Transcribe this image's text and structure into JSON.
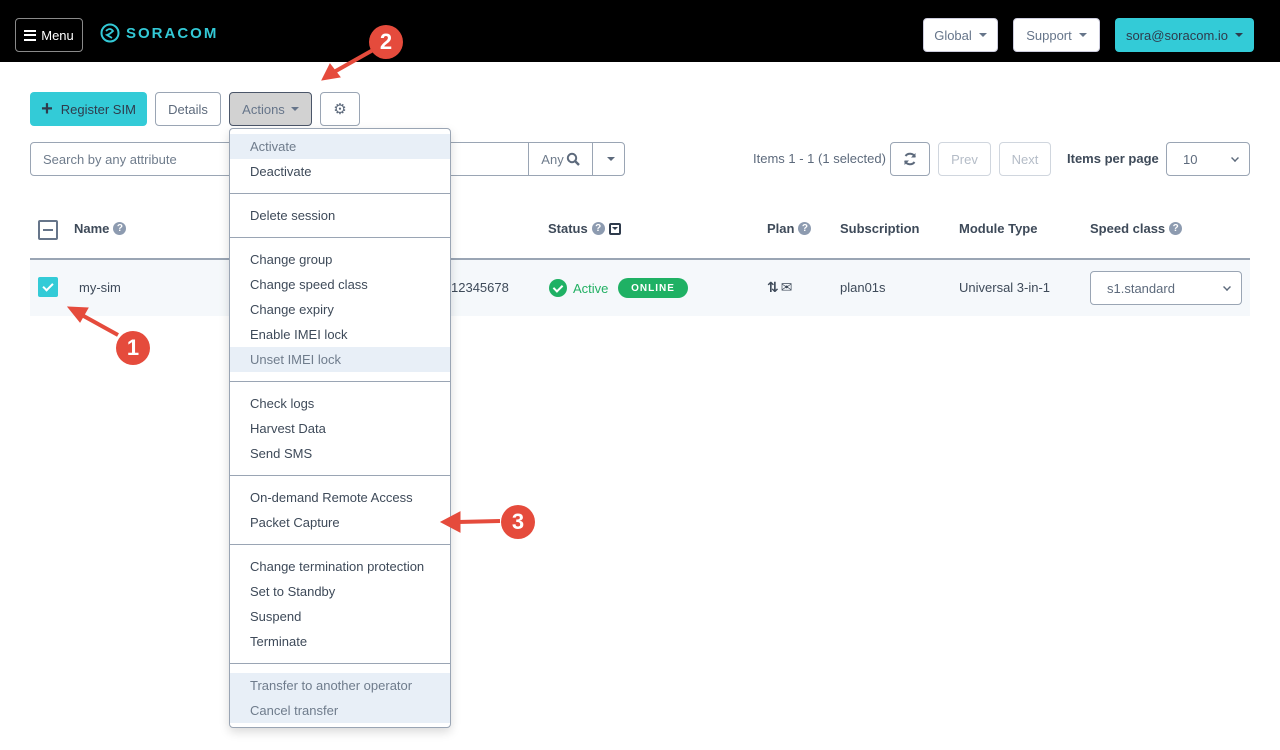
{
  "topbar": {
    "menu_label": "Menu",
    "logo_text": "SORACOM",
    "region_label": "Global",
    "support_label": "Support",
    "user_label": "sora@soracom.io"
  },
  "toolbar": {
    "register_label": "Register SIM",
    "details_label": "Details",
    "actions_label": "Actions"
  },
  "search": {
    "placeholder": "Search by any attribute",
    "value": "",
    "scope_label": "Any"
  },
  "pagination": {
    "items_text": "Items 1 - 1 (1 selected)",
    "prev_label": "Prev",
    "next_label": "Next",
    "items_per_page_label": "Items per page",
    "items_per_page_value": "10"
  },
  "table": {
    "columns": {
      "name": "Name",
      "status": "Status",
      "plan": "Plan",
      "subscription": "Subscription",
      "module_type": "Module Type",
      "speed_class": "Speed class"
    },
    "rows": [
      {
        "selected": true,
        "name": "my-sim",
        "id_partial": "12345678",
        "status": "Active",
        "session": "ONLINE",
        "plan_icons": [
          "data-updown-icon",
          "sms-envelope-icon"
        ],
        "subscription": "plan01s",
        "module_type": "Universal 3-in-1",
        "speed_class": "s1.standard"
      }
    ]
  },
  "actions_menu": {
    "groups": [
      [
        {
          "label": "Activate",
          "disabled": true
        },
        {
          "label": "Deactivate",
          "disabled": false
        }
      ],
      [
        {
          "label": "Delete session",
          "disabled": false
        }
      ],
      [
        {
          "label": "Change group",
          "disabled": false
        },
        {
          "label": "Change speed class",
          "disabled": false
        },
        {
          "label": "Change expiry",
          "disabled": false
        },
        {
          "label": "Enable IMEI lock",
          "disabled": false
        },
        {
          "label": "Unset IMEI lock",
          "disabled": true
        }
      ],
      [
        {
          "label": "Check logs",
          "disabled": false
        },
        {
          "label": "Harvest Data",
          "disabled": false
        },
        {
          "label": "Send SMS",
          "disabled": false
        }
      ],
      [
        {
          "label": "On-demand Remote Access",
          "disabled": false
        },
        {
          "label": "Packet Capture",
          "disabled": false
        }
      ],
      [
        {
          "label": "Change termination protection",
          "disabled": false
        },
        {
          "label": "Set to Standby",
          "disabled": false
        },
        {
          "label": "Suspend",
          "disabled": false
        },
        {
          "label": "Terminate",
          "disabled": false
        }
      ],
      [
        {
          "label": "Transfer to another operator",
          "disabled": true
        },
        {
          "label": "Cancel transfer",
          "disabled": true
        }
      ]
    ]
  },
  "annotations": [
    "1",
    "2",
    "3"
  ],
  "colors": {
    "brand_teal": "#33cbd7",
    "online_green": "#1fb164",
    "callout_red": "#e54b3c"
  }
}
